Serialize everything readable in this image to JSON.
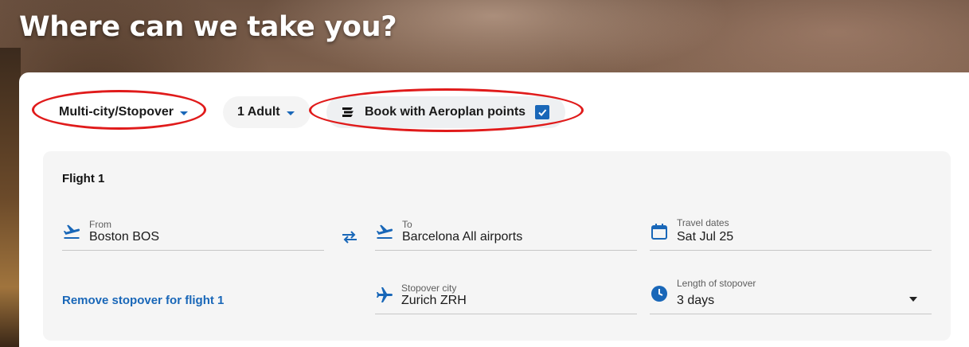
{
  "page": {
    "title": "Where can we take you?"
  },
  "toolbar": {
    "trip_type": "Multi-city/Stopover",
    "passengers": "1 Adult",
    "points_label": "Book with Aeroplan points",
    "points_checked": true
  },
  "flight": {
    "heading": "Flight 1",
    "from": {
      "label": "From",
      "value": "Boston BOS"
    },
    "to": {
      "label": "To",
      "value": "Barcelona All airports"
    },
    "dates": {
      "label": "Travel dates",
      "value": "Sat Jul 25"
    },
    "remove_stopover": "Remove stopover for flight 1",
    "stopover_city": {
      "label": "Stopover city",
      "value": "Zurich ZRH"
    },
    "stopover_length": {
      "label": "Length of stopover",
      "value": "3 days"
    }
  },
  "colors": {
    "accent": "#1967b8",
    "annotation": "#e01b1b"
  }
}
